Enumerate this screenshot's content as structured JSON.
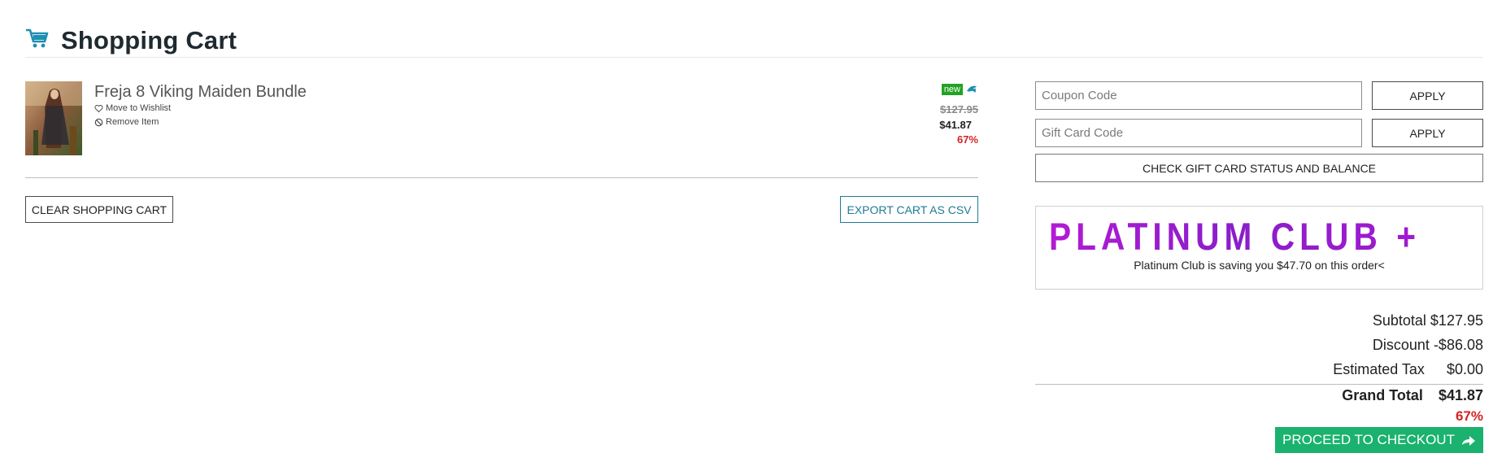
{
  "header": {
    "title": "Shopping Cart",
    "icon": "shopping-cart-icon",
    "icon_color": "#1e8fb0"
  },
  "cart_items": [
    {
      "title": "Freja 8 Viking Maiden Bundle",
      "wishlist_label": "Move to Wishlist",
      "remove_label": "Remove Item",
      "badge": "new",
      "badge_color": "#24a224",
      "original_price": "$127.95",
      "price": "$41.87",
      "discount_pct": "67%"
    }
  ],
  "actions": {
    "clear_label": "CLEAR SHOPPING CART",
    "export_label": "EXPORT CART AS CSV"
  },
  "codes": {
    "coupon_placeholder": "Coupon Code",
    "gift_placeholder": "Gift Card Code",
    "apply_label": "APPLY",
    "check_label": "CHECK GIFT CARD STATUS AND BALANCE"
  },
  "platinum": {
    "logo_text": "PLATINUM CLUB +",
    "message": "Platinum Club is saving you $47.70 on this order<"
  },
  "totals": {
    "subtotal_label": "Subtotal",
    "subtotal_value": "$127.95",
    "discount_label": "Discount",
    "discount_value": "-$86.08",
    "tax_label": "Estimated Tax",
    "tax_value": "$0.00",
    "grand_label": "Grand Total",
    "grand_value": "$41.87",
    "savings_pct": "67%"
  },
  "checkout": {
    "label": "PROCEED TO CHECKOUT",
    "color": "#1ab26e"
  },
  "colors": {
    "accent": "#1e8fb0",
    "sale_red": "#d32424",
    "success_green": "#1ab26e"
  }
}
